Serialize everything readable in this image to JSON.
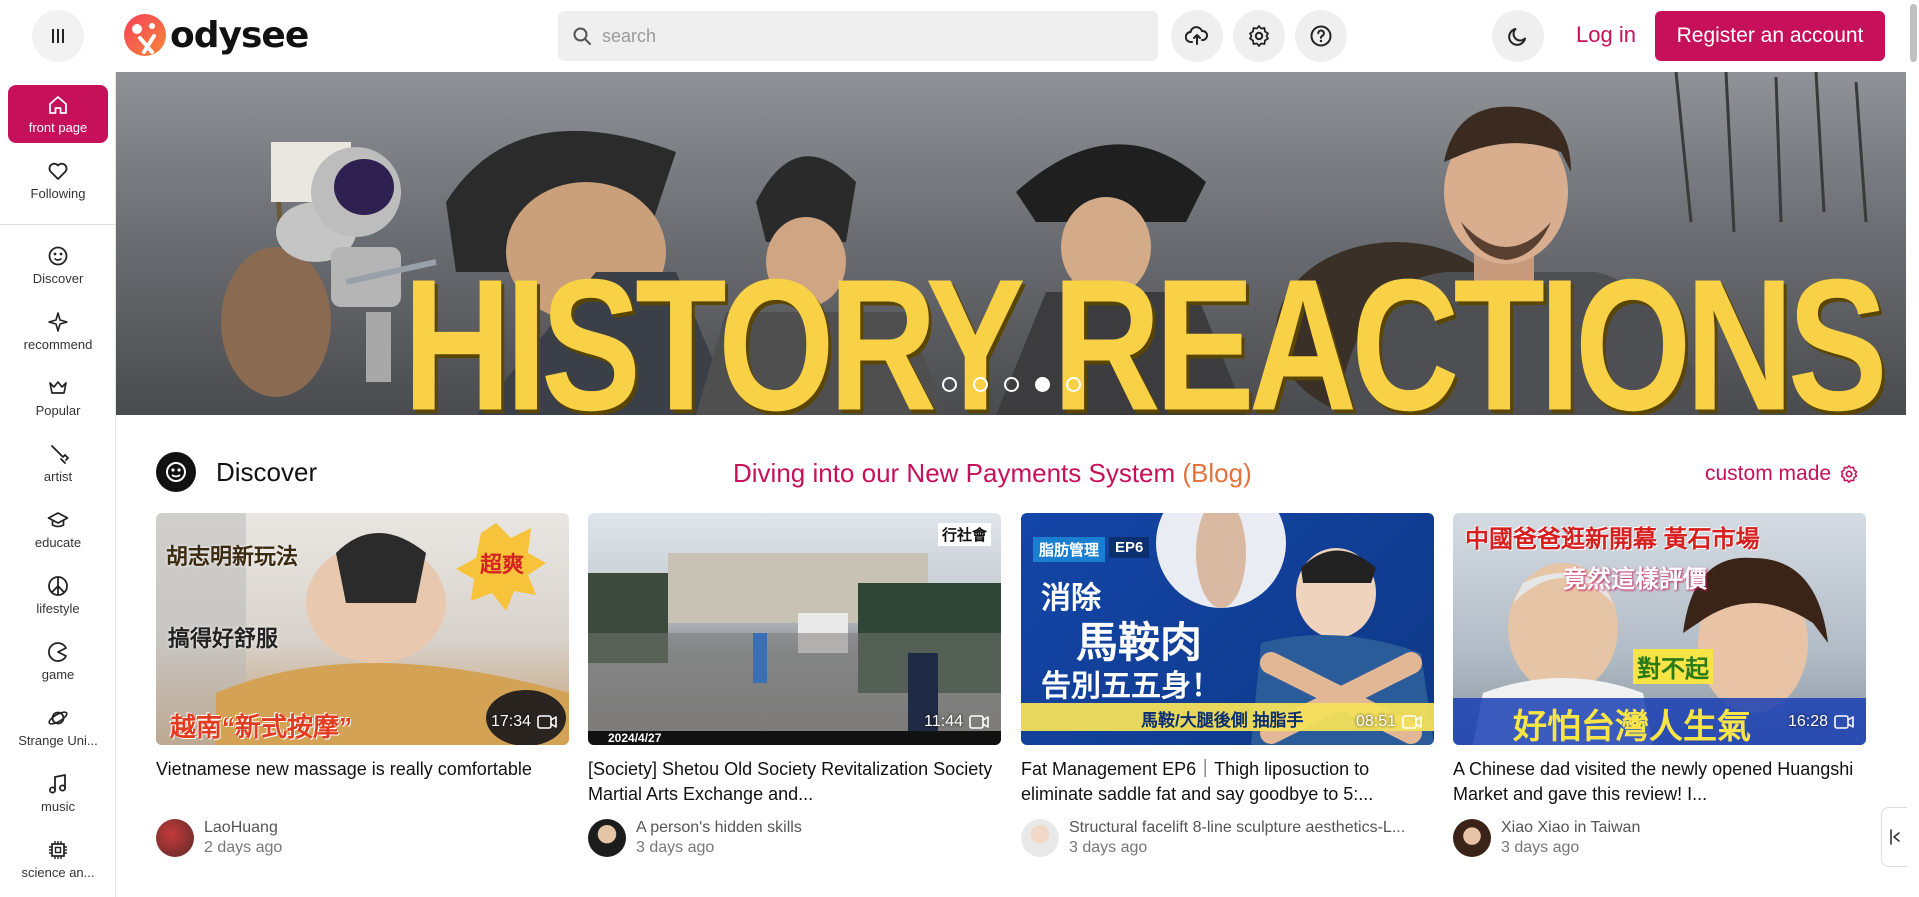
{
  "header": {
    "logo_text": "odysee",
    "search_placeholder": "search",
    "login_label": "Log in",
    "register_label": "Register an account",
    "icons": [
      "menu-icon",
      "upload-icon",
      "settings-icon",
      "help-icon",
      "dark-mode-icon"
    ]
  },
  "sidebar": {
    "items": [
      {
        "label": "front page",
        "icon": "home-icon",
        "active": true
      },
      {
        "label": "Following",
        "icon": "heart-icon"
      },
      {
        "label": "Discover",
        "icon": "discover-icon"
      },
      {
        "label": "recommend",
        "icon": "sparkle-icon"
      },
      {
        "label": "Popular",
        "icon": "popular-icon"
      },
      {
        "label": "artist",
        "icon": "brush-icon"
      },
      {
        "label": "educate",
        "icon": "graduation-cap-icon"
      },
      {
        "label": "lifestyle",
        "icon": "peace-icon"
      },
      {
        "label": "game",
        "icon": "pacman-icon"
      },
      {
        "label": "Strange Uni...",
        "icon": "planet-icon"
      },
      {
        "label": "music",
        "icon": "music-note-icon"
      },
      {
        "label": "science an...",
        "icon": "chip-icon"
      }
    ]
  },
  "hero": {
    "title": "HISTORY REACTIONS",
    "slide_count": 5,
    "active_slide": 4
  },
  "section": {
    "title": "Discover",
    "blog_link_main": "Diving into our New Payments System ",
    "blog_link_tail": "(Blog)",
    "custom_label": "custom made"
  },
  "cards": [
    {
      "title": "Vietnamese new massage is really comfortable",
      "duration": "17:34",
      "channel": "LaoHuang",
      "time": "2 days ago",
      "thumb_texts": [
        "胡志明新玩法",
        "搞得好舒服",
        "超爽",
        "越南“新式按摩”"
      ]
    },
    {
      "title": "[Society] Shetou Old Society Revitalization Society Martial Arts Exchange and...",
      "duration": "11:44",
      "channel": "A person's hidden skills",
      "time": "3 days ago",
      "thumb_texts": [
        "行社會",
        "2024/4/27"
      ]
    },
    {
      "title": "Fat Management EP6｜Thigh liposuction to eliminate saddle fat and say goodbye to 5:...",
      "duration": "08:51",
      "channel": "Structural facelift 8-line sculpture aesthetics-L...",
      "time": "3 days ago",
      "thumb_texts": [
        "脂肪管理",
        "EP6",
        "消除",
        "馬鞍肉",
        "告別五五身！",
        "馬鞍/大腿後側 抽脂手"
      ]
    },
    {
      "title": "A Chinese dad visited the newly opened Huangshi Market and gave this review! I...",
      "duration": "16:28",
      "channel": "Xiao Xiao in Taiwan",
      "time": "3 days ago",
      "thumb_texts": [
        "中國爸爸逛新開幕 黃石市場",
        "竟然這樣評價",
        "對不起",
        "好怕台灣人生氣"
      ]
    }
  ],
  "colors": {
    "accent": "#c7105a",
    "blog_tail": "#e2733a",
    "hero_title": "#f8d146"
  }
}
